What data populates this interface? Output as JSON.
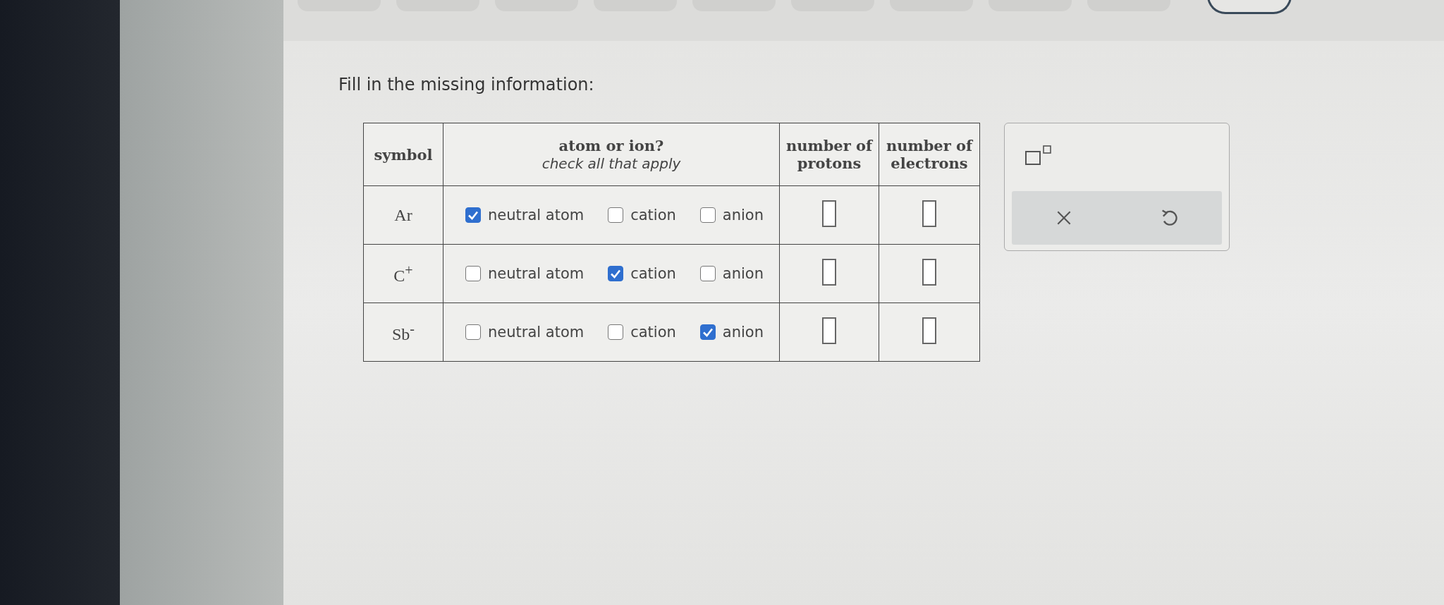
{
  "toolbar": {
    "buttons": [
      {
        "kind": "tab"
      },
      {
        "kind": "tab"
      },
      {
        "kind": "tab"
      },
      {
        "kind": "tab"
      },
      {
        "kind": "tab"
      },
      {
        "kind": "tab"
      },
      {
        "kind": "tab"
      },
      {
        "kind": "tab"
      },
      {
        "kind": "tab"
      },
      {
        "kind": "circle"
      }
    ]
  },
  "prompt": "Fill in the missing information:",
  "table": {
    "columns": [
      {
        "title": "symbol"
      },
      {
        "title": "atom or ion?",
        "subtitle": "check all that apply"
      },
      {
        "title": "number of protons"
      },
      {
        "title": "number of electrons"
      }
    ],
    "rows": [
      {
        "symbol": "Ar",
        "options": [
          {
            "label": "neutral atom",
            "checked": true
          },
          {
            "label": "cation",
            "checked": false
          },
          {
            "label": "anion",
            "checked": false
          }
        ]
      },
      {
        "symbol": "C$^{+}$",
        "options": [
          {
            "label": "neutral atom",
            "checked": false
          },
          {
            "label": "cation",
            "checked": true
          },
          {
            "label": "anion",
            "checked": false
          }
        ]
      },
      {
        "symbol": "Sb$^{-}$",
        "options": [
          {
            "label": "neutral atom",
            "checked": false
          },
          {
            "label": "cation",
            "checked": false
          },
          {
            "label": "anion",
            "checked": true
          }
        ]
      }
    ]
  },
  "tools": [
    {
      "kind": "superscript"
    },
    {
      "kind": "clear"
    },
    {
      "kind": "undo"
    }
  ]
}
